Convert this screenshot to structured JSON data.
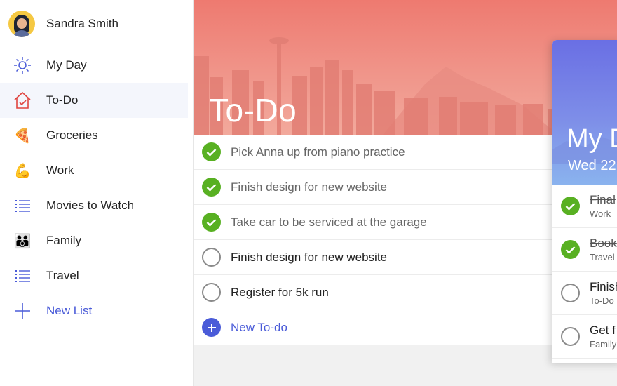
{
  "user": {
    "name": "Sandra Smith"
  },
  "sidebar": {
    "items": [
      {
        "label": "My Day",
        "icon": "sun-icon"
      },
      {
        "label": "To-Do",
        "icon": "home-check-icon",
        "selected": true
      },
      {
        "label": "Groceries",
        "icon": "pizza-icon"
      },
      {
        "label": "Work",
        "icon": "flexed-biceps-icon"
      },
      {
        "label": "Movies to Watch",
        "icon": "list-icon"
      },
      {
        "label": "Family",
        "icon": "family-icon"
      },
      {
        "label": "Travel",
        "icon": "list-icon"
      }
    ],
    "new_list_label": "New List"
  },
  "main": {
    "title": "To-Do",
    "tasks": [
      {
        "label": "Pick Anna up from piano practice",
        "completed": true
      },
      {
        "label": "Finish design for new website",
        "completed": true
      },
      {
        "label": "Take car to be serviced at the garage",
        "completed": true
      },
      {
        "label": "Finish design for new website",
        "completed": false
      },
      {
        "label": "Register for 5k run",
        "completed": false
      }
    ],
    "new_task_label": "New To-do"
  },
  "my_day_card": {
    "title": "My D",
    "date": "Wed 22",
    "tasks": [
      {
        "title": "Final",
        "list": "Work",
        "completed": true
      },
      {
        "title": "Book",
        "list": "Travel",
        "completed": true
      },
      {
        "title": "Finish",
        "list": "To-Do",
        "completed": false
      },
      {
        "title": "Get f",
        "list": "Family",
        "completed": false
      }
    ]
  },
  "colors": {
    "accent": "#4a5bd8",
    "complete_green": "#58b022",
    "hero_red": "#ee7a70",
    "card_blue": "#6a6fe4"
  }
}
